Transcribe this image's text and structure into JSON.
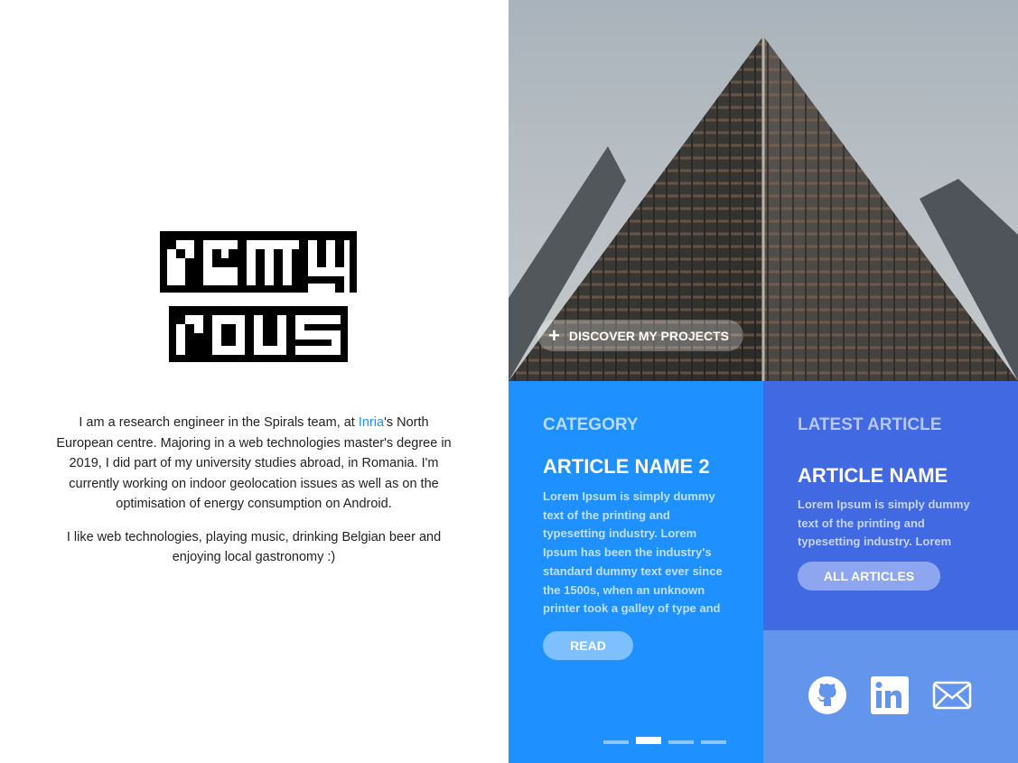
{
  "profile": {
    "logo_text": "remy rous",
    "bio_before_link": "I am a research engineer in the Spirals team, at ",
    "bio_link": "Inria",
    "bio_after_link": "'s North European centre. Majoring in a web technologies master's degree in 2019, I did part of my university studies abroad, in Romania. I'm currently working on indoor geolocation issues as well as on the optimisation of energy consumption on Android.",
    "bio_second": "I like web technologies, playing music, drinking Belgian beer and enjoying local gastronomy :)"
  },
  "hero": {
    "discover_label": "DISCOVER MY PROJECTS",
    "plus_icon": "+"
  },
  "article": {
    "category": "CATEGORY",
    "title": "ARTICLE NAME 2",
    "text": "Lorem Ipsum is simply dummy text of the printing and typesetting industry. Lorem Ipsum has been the industry's standard dummy text ever since the 1500s, when an unknown printer took a galley of type and",
    "read_label": "READ",
    "active_slide": 2,
    "slide_count": 4
  },
  "latest": {
    "label": "LATEST ARTICLE",
    "title": "ARTICLE NAME",
    "text": "Lorem Ipsum is simply dummy text of the printing and typesetting industry. Lorem",
    "button_label": "ALL ARTICLES"
  },
  "social": {
    "icons": [
      "github-icon",
      "linkedin-icon",
      "mail-icon"
    ]
  },
  "colors": {
    "article_bg": "#1e90ff",
    "latest_bg": "#4169e1",
    "social_bg": "#6495ed"
  }
}
